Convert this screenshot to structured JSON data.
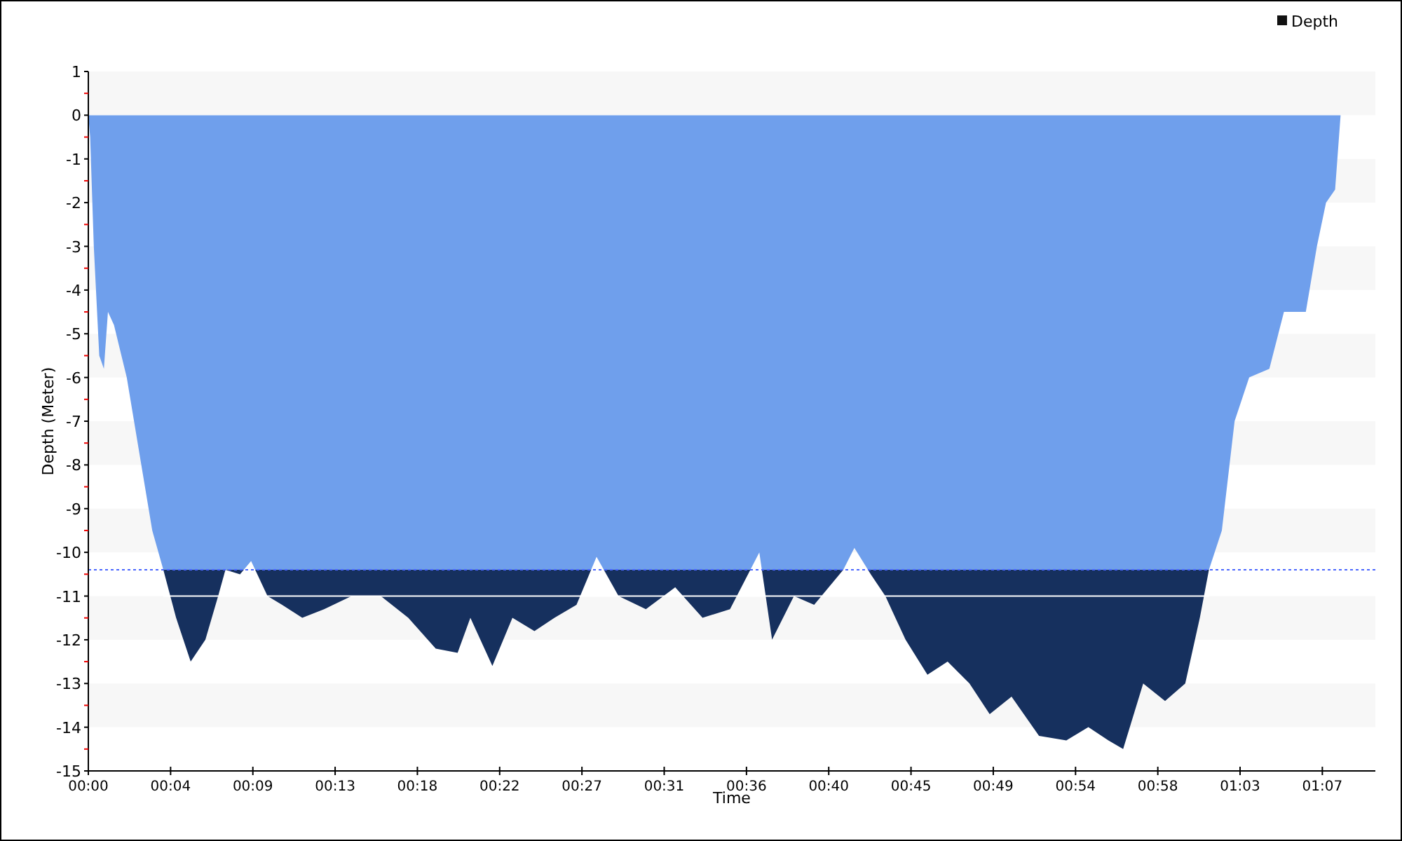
{
  "chart_data": {
    "type": "area",
    "xlabel": "Time",
    "ylabel": "Depth (Meter)",
    "xlim": [
      0,
      70.4
    ],
    "ylim": [
      -15,
      1
    ],
    "xticks": [
      {
        "value": 0,
        "label": "00:00"
      },
      {
        "value": 4.5,
        "label": "00:04"
      },
      {
        "value": 9,
        "label": "00:09"
      },
      {
        "value": 13.5,
        "label": "00:13"
      },
      {
        "value": 18,
        "label": "00:18"
      },
      {
        "value": 22.5,
        "label": "00:22"
      },
      {
        "value": 27,
        "label": "00:27"
      },
      {
        "value": 31.5,
        "label": "00:31"
      },
      {
        "value": 36,
        "label": "00:36"
      },
      {
        "value": 40.5,
        "label": "00:40"
      },
      {
        "value": 45,
        "label": "00:45"
      },
      {
        "value": 49.5,
        "label": "00:49"
      },
      {
        "value": 54,
        "label": "00:54"
      },
      {
        "value": 58.5,
        "label": "00:58"
      },
      {
        "value": 63,
        "label": "01:03"
      },
      {
        "value": 67.5,
        "label": "01:07"
      }
    ],
    "yticks": [
      1,
      0,
      -1,
      -2,
      -3,
      -4,
      -5,
      -6,
      -7,
      -8,
      -9,
      -10,
      -11,
      -12,
      -13,
      -14,
      -15
    ],
    "x": [
      0,
      0.1,
      0.3,
      0.6,
      0.85,
      1.07,
      1.4,
      2.1,
      2.9,
      3.5,
      4.1,
      4.8,
      5.6,
      6.4,
      7.1,
      7.5,
      8.3,
      8.9,
      9.8,
      10.6,
      11.7,
      12.9,
      14.4,
      16,
      17.5,
      19,
      20.2,
      20.9,
      22.1,
      23.2,
      24.4,
      25.5,
      26.7,
      27.8,
      29,
      30.5,
      32.1,
      33.6,
      35.1,
      36.7,
      37.4,
      38.6,
      39.7,
      41.3,
      41.9,
      42.8,
      43.6,
      44.7,
      45.9,
      47,
      48.2,
      49.3,
      50.5,
      52,
      53.5,
      54.7,
      55.8,
      56.6,
      57.7,
      58.9,
      60,
      60.8,
      61.3,
      62,
      62.7,
      63.5,
      64.6,
      65.4,
      66.6,
      67.2,
      67.7,
      68.2,
      68.5
    ],
    "series": [
      {
        "name": "Depth",
        "color": "#6f9fec",
        "values": [
          0,
          -0.5,
          -3,
          -5.5,
          -5.8,
          -4.5,
          -4.8,
          -6,
          -8,
          -9.5,
          -10.4,
          -11.5,
          -12.5,
          -12,
          -11,
          -10.4,
          -10.5,
          -10.2,
          -11,
          -11.2,
          -11.5,
          -11.3,
          -11,
          -11,
          -11.5,
          -12.2,
          -12.3,
          -11.5,
          -12.6,
          -11.5,
          -11.8,
          -11.5,
          -11.2,
          -10.1,
          -11,
          -11.3,
          -10.8,
          -11.5,
          -11.3,
          -10,
          -12,
          -11,
          -11.2,
          -10.4,
          -9.9,
          -10.5,
          -11,
          -12,
          -12.8,
          -12.5,
          -13,
          -13.7,
          -13.3,
          -14.2,
          -14.3,
          -14,
          -14.3,
          -14.5,
          -13,
          -13.4,
          -13,
          -11.5,
          -10.4,
          -9.5,
          -7,
          -6,
          -5.8,
          -4.5,
          -4.5,
          -3,
          -2,
          -1.7,
          0
        ]
      }
    ],
    "ref_lines": [
      {
        "axis": "y",
        "value": -10.4
      },
      {
        "axis": "y",
        "value": -11
      }
    ]
  }
}
